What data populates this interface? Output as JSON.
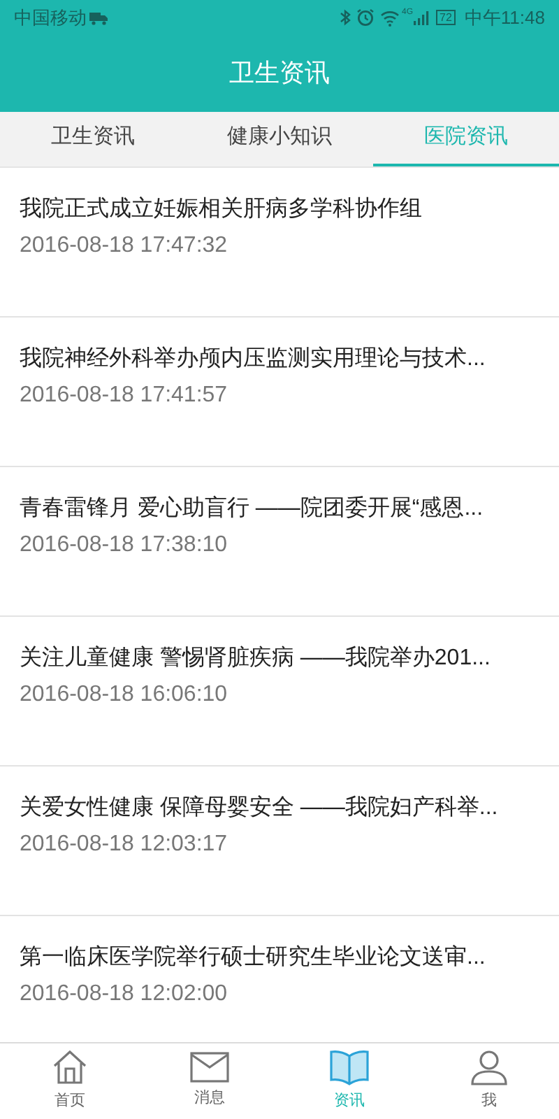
{
  "status_bar": {
    "carrier": "中国移动",
    "network": "4G",
    "battery": "72",
    "time": "中午11:48"
  },
  "header": {
    "title": "卫生资讯"
  },
  "tabs": [
    {
      "label": "卫生资讯",
      "selected": false
    },
    {
      "label": "健康小知识",
      "selected": false
    },
    {
      "label": "医院资讯",
      "selected": true
    }
  ],
  "articles": [
    {
      "title": "我院正式成立妊娠相关肝病多学科协作组",
      "time": "2016-08-18 17:47:32"
    },
    {
      "title": "我院神经外科举办颅内压监测实用理论与技术...",
      "time": "2016-08-18 17:41:57"
    },
    {
      "title": "青春雷锋月 爱心助盲行 ——院团委开展“感恩...",
      "time": "2016-08-18 17:38:10"
    },
    {
      "title": "关注儿童健康 警惕肾脏疾病 ——我院举办201...",
      "time": "2016-08-18 16:06:10"
    },
    {
      "title": "关爱女性健康 保障母婴安全 ——我院妇产科举...",
      "time": "2016-08-18 12:03:17"
    },
    {
      "title": "第一临床医学院举行硕士研究生毕业论文送审...",
      "time": "2016-08-18 12:02:00"
    }
  ],
  "bottom_nav": [
    {
      "kind": "home",
      "label": "首页",
      "selected": false
    },
    {
      "kind": "mail",
      "label": "消息",
      "selected": false
    },
    {
      "kind": "book",
      "label": "资讯",
      "selected": true
    },
    {
      "kind": "person",
      "label": "我",
      "selected": false
    }
  ]
}
